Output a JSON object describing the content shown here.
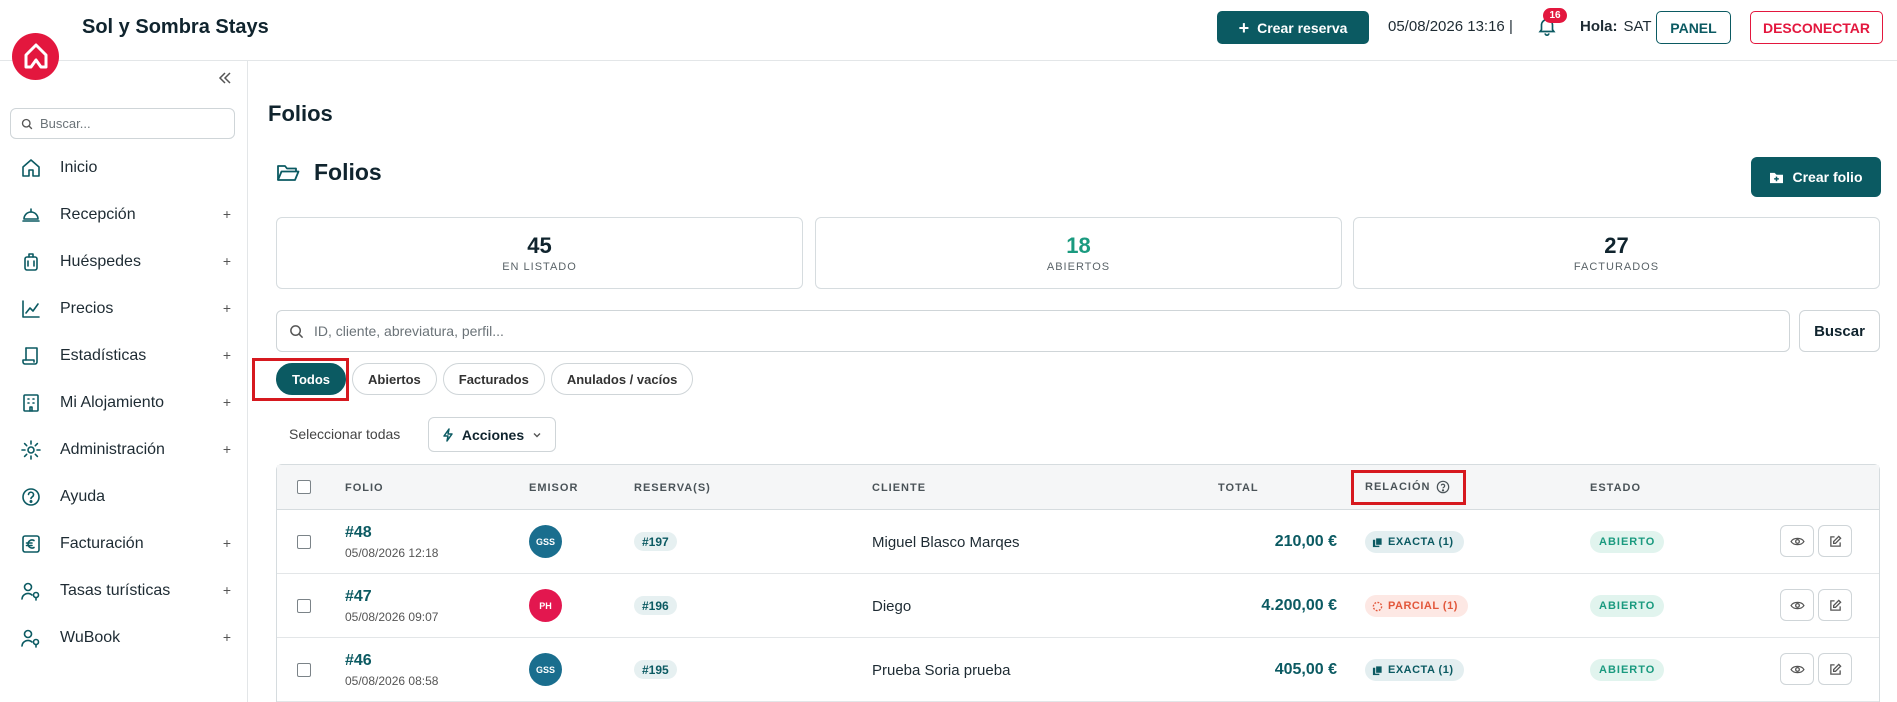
{
  "header": {
    "app_title": "Sol y Sombra Stays",
    "crear_reserva": "Crear reserva",
    "datetime": "05/08/2026 13:16 |",
    "notifications_count": "16",
    "hola_label": "Hola:",
    "user": "SAT",
    "panel": "PANEL",
    "desconectar": "DESCONECTAR"
  },
  "sidebar": {
    "search_placeholder": "Buscar...",
    "items": [
      {
        "label": "Inicio",
        "icon": "home-icon",
        "expandable": false
      },
      {
        "label": "Recepción",
        "icon": "bell-service-icon",
        "expandable": true
      },
      {
        "label": "Huéspedes",
        "icon": "luggage-icon",
        "expandable": true
      },
      {
        "label": "Precios",
        "icon": "chart-line-icon",
        "expandable": true
      },
      {
        "label": "Estadísticas",
        "icon": "scroll-icon",
        "expandable": true
      },
      {
        "label": "Mi Alojamiento",
        "icon": "building-icon",
        "expandable": true
      },
      {
        "label": "Administración",
        "icon": "gear-icon",
        "expandable": true
      },
      {
        "label": "Ayuda",
        "icon": "help-circle-icon",
        "expandable": false
      },
      {
        "label": "Facturación",
        "icon": "euro-icon",
        "expandable": true
      },
      {
        "label": "Tasas turísticas",
        "icon": "user-key-icon",
        "expandable": true
      },
      {
        "label": "WuBook",
        "icon": "user-key-icon",
        "expandable": true
      }
    ],
    "plus": "+"
  },
  "main": {
    "page_title": "Folios",
    "section_title": "Folios",
    "crear_folio": "Crear folio",
    "stats": [
      {
        "value": "45",
        "label": "EN LISTADO"
      },
      {
        "value": "18",
        "label": "ABIERTOS"
      },
      {
        "value": "27",
        "label": "FACTURADOS"
      }
    ],
    "search_placeholder": "ID, cliente, abreviatura, perfil...",
    "buscar": "Buscar",
    "filters": [
      "Todos",
      "Abiertos",
      "Facturados",
      "Anulados / vacíos"
    ],
    "active_filter": "Todos",
    "select_all": "Seleccionar todas",
    "acciones": "Acciones"
  },
  "table": {
    "headers": {
      "folio": "FOLIO",
      "emisor": "EMISOR",
      "reservas": "RESERVA(S)",
      "cliente": "CLIENTE",
      "total": "TOTAL",
      "relacion": "RELACIÓN",
      "estado": "ESTADO"
    },
    "rows": [
      {
        "folio": "#48",
        "date": "05/08/2026 12:18",
        "emisor": "GSS",
        "emisor_color": "#1a6e8e",
        "reserva": "#197",
        "cliente": "Miguel Blasco Marqes",
        "total": "210,00 €",
        "relacion": "EXACTA (1)",
        "relacion_type": "exacta",
        "estado": "ABIERTO"
      },
      {
        "folio": "#47",
        "date": "05/08/2026 09:07",
        "emisor": "PH",
        "emisor_color": "#e3174f",
        "reserva": "#196",
        "cliente": "Diego",
        "total": "4.200,00 €",
        "relacion": "PARCIAL (1)",
        "relacion_type": "parcial",
        "estado": "ABIERTO"
      },
      {
        "folio": "#46",
        "date": "05/08/2026 08:58",
        "emisor": "GSS",
        "emisor_color": "#1a6e8e",
        "reserva": "#195",
        "cliente": "Prueba Soria prueba",
        "total": "405,00 €",
        "relacion": "EXACTA (1)",
        "relacion_type": "exacta",
        "estado": "ABIERTO"
      }
    ]
  },
  "colors": {
    "primary": "#0b5a62",
    "brand_red": "#e3173e",
    "open_green": "#1a9a7f",
    "highlight": "#d6191f"
  }
}
